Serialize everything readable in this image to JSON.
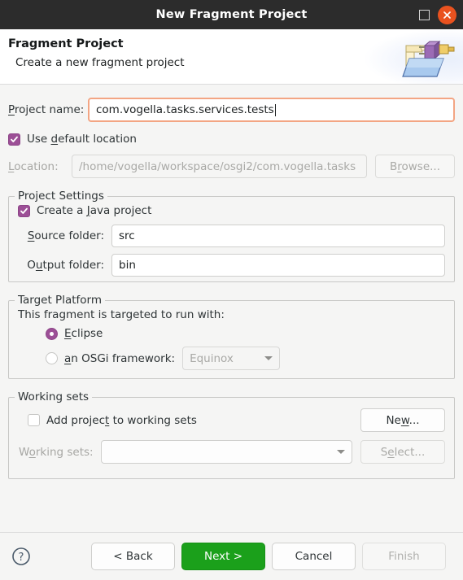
{
  "window": {
    "title": "New Fragment Project",
    "maximize_icon": "maximize-icon",
    "close_icon": "close-icon",
    "titlebar_bg": "#2c2c2c",
    "close_bg": "#e9521f"
  },
  "header": {
    "title": "Fragment Project",
    "subtitle": "Create a new fragment project",
    "icon": "folder-plugin-icon"
  },
  "project_name": {
    "label": "Project name:",
    "label_accel": "P",
    "value": "com.vogella.tasks.services.tests",
    "focused": true,
    "focus_border": "#f3a583"
  },
  "use_default_location": {
    "label": "Use default location",
    "label_accel": "d",
    "checked": true
  },
  "location": {
    "label": "Location:",
    "label_accel": "L",
    "value": "/home/vogella/workspace/osgi2/com.vogella.tasks",
    "enabled": false,
    "browse_label": "Browse...",
    "browse_accel": "r"
  },
  "project_settings": {
    "group_title": "Project Settings",
    "create_java_project": {
      "label": "Create a Java project",
      "label_accel": "J",
      "checked": true
    },
    "source_folder": {
      "label": "Source folder:",
      "label_accel": "S",
      "value": "src"
    },
    "output_folder": {
      "label": "Output folder:",
      "label_accel": "u",
      "value": "bin"
    }
  },
  "target_platform": {
    "group_title": "Target Platform",
    "description": "This fragment is targeted to run with:",
    "options": [
      {
        "label": "Eclipse",
        "label_accel": "E",
        "selected": true
      },
      {
        "label": "an OSGi framework:",
        "label_accel": "a",
        "selected": false
      }
    ],
    "framework_combo": {
      "value": "Equinox",
      "enabled": false
    }
  },
  "working_sets": {
    "group_title": "Working sets",
    "add_to_working_sets": {
      "label": "Add project to working sets",
      "label_accel": "t",
      "checked": false
    },
    "new_button": {
      "label": "New...",
      "accel": "w"
    },
    "working_sets_label": "Working sets:",
    "working_sets_accel": "o",
    "working_sets_value": "",
    "select_button": {
      "label": "Select...",
      "accel": "e"
    }
  },
  "footer": {
    "help_icon": "help-icon",
    "buttons": [
      {
        "label": "< Back",
        "state": "enabled"
      },
      {
        "label": "Next >",
        "state": "primary"
      },
      {
        "label": "Cancel",
        "state": "enabled"
      },
      {
        "label": "Finish",
        "state": "disabled"
      }
    ]
  },
  "colors": {
    "accent_purple": "#9c4f96",
    "primary_green": "#1ba01b",
    "close_orange": "#e9521f"
  }
}
